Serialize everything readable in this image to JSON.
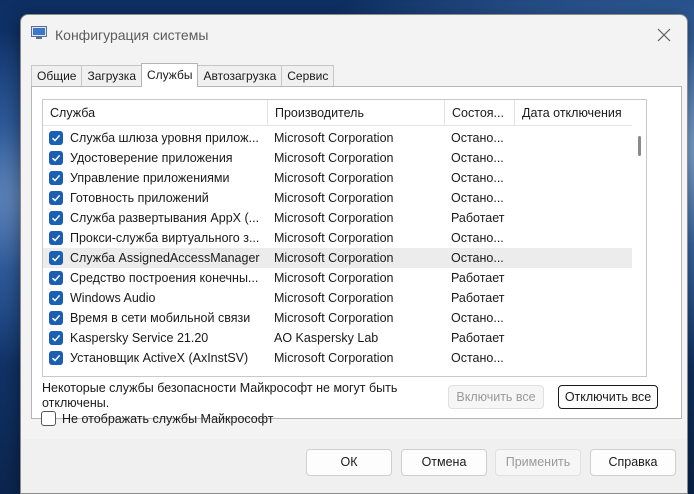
{
  "window": {
    "title": "Конфигурация системы",
    "icons": {
      "app": "msconfig-icon",
      "close": "close-icon"
    }
  },
  "tabs": [
    {
      "label": "Общие",
      "active": false
    },
    {
      "label": "Загрузка",
      "active": false
    },
    {
      "label": "Службы",
      "active": true
    },
    {
      "label": "Автозагрузка",
      "active": false
    },
    {
      "label": "Сервис",
      "active": false
    }
  ],
  "services": {
    "columns": [
      "Служба",
      "Производитель",
      "Состоя...",
      "Дата отключения"
    ],
    "rows": [
      {
        "name": "Служба шлюза уровня прилож...",
        "manufacturer": "Microsoft Corporation",
        "status": "Остано...",
        "checked": true
      },
      {
        "name": "Удостоверение приложения",
        "manufacturer": "Microsoft Corporation",
        "status": "Остано...",
        "checked": true
      },
      {
        "name": "Управление приложениями",
        "manufacturer": "Microsoft Corporation",
        "status": "Остано...",
        "checked": true
      },
      {
        "name": "Готовность приложений",
        "manufacturer": "Microsoft Corporation",
        "status": "Остано...",
        "checked": true
      },
      {
        "name": "Служба развертывания AppX (...",
        "manufacturer": "Microsoft Corporation",
        "status": "Работает",
        "checked": true
      },
      {
        "name": "Прокси-служба виртуального з...",
        "manufacturer": "Microsoft Corporation",
        "status": "Остано...",
        "checked": true
      },
      {
        "name": "Служба AssignedAccessManager",
        "manufacturer": "Microsoft Corporation",
        "status": "Остано...",
        "checked": true,
        "selected": true
      },
      {
        "name": "Средство построения конечны...",
        "manufacturer": "Microsoft Corporation",
        "status": "Работает",
        "checked": true
      },
      {
        "name": "Windows Audio",
        "manufacturer": "Microsoft Corporation",
        "status": "Работает",
        "checked": true
      },
      {
        "name": "Время в сети мобильной связи",
        "manufacturer": "Microsoft Corporation",
        "status": "Остано...",
        "checked": true
      },
      {
        "name": "Kaspersky Service 21.20",
        "manufacturer": "AO Kaspersky Lab",
        "status": "Работает",
        "checked": true
      },
      {
        "name": "Установщик ActiveX (AxInstSV)",
        "manufacturer": "Microsoft Corporation",
        "status": "Остано...",
        "checked": true
      }
    ],
    "note": "Некоторые службы безопасности Майкрософт не могут быть отключены.",
    "enable_all": "Включить все",
    "disable_all": "Отключить все",
    "hide_ms_label": "Не отображать службы Майкрософт",
    "hide_ms_checked": false
  },
  "footer": {
    "ok": "ОК",
    "cancel": "Отмена",
    "apply": "Применить",
    "help": "Справка"
  },
  "colors": {
    "accent": "#1a5fb4",
    "selected_row": "#ececec"
  }
}
